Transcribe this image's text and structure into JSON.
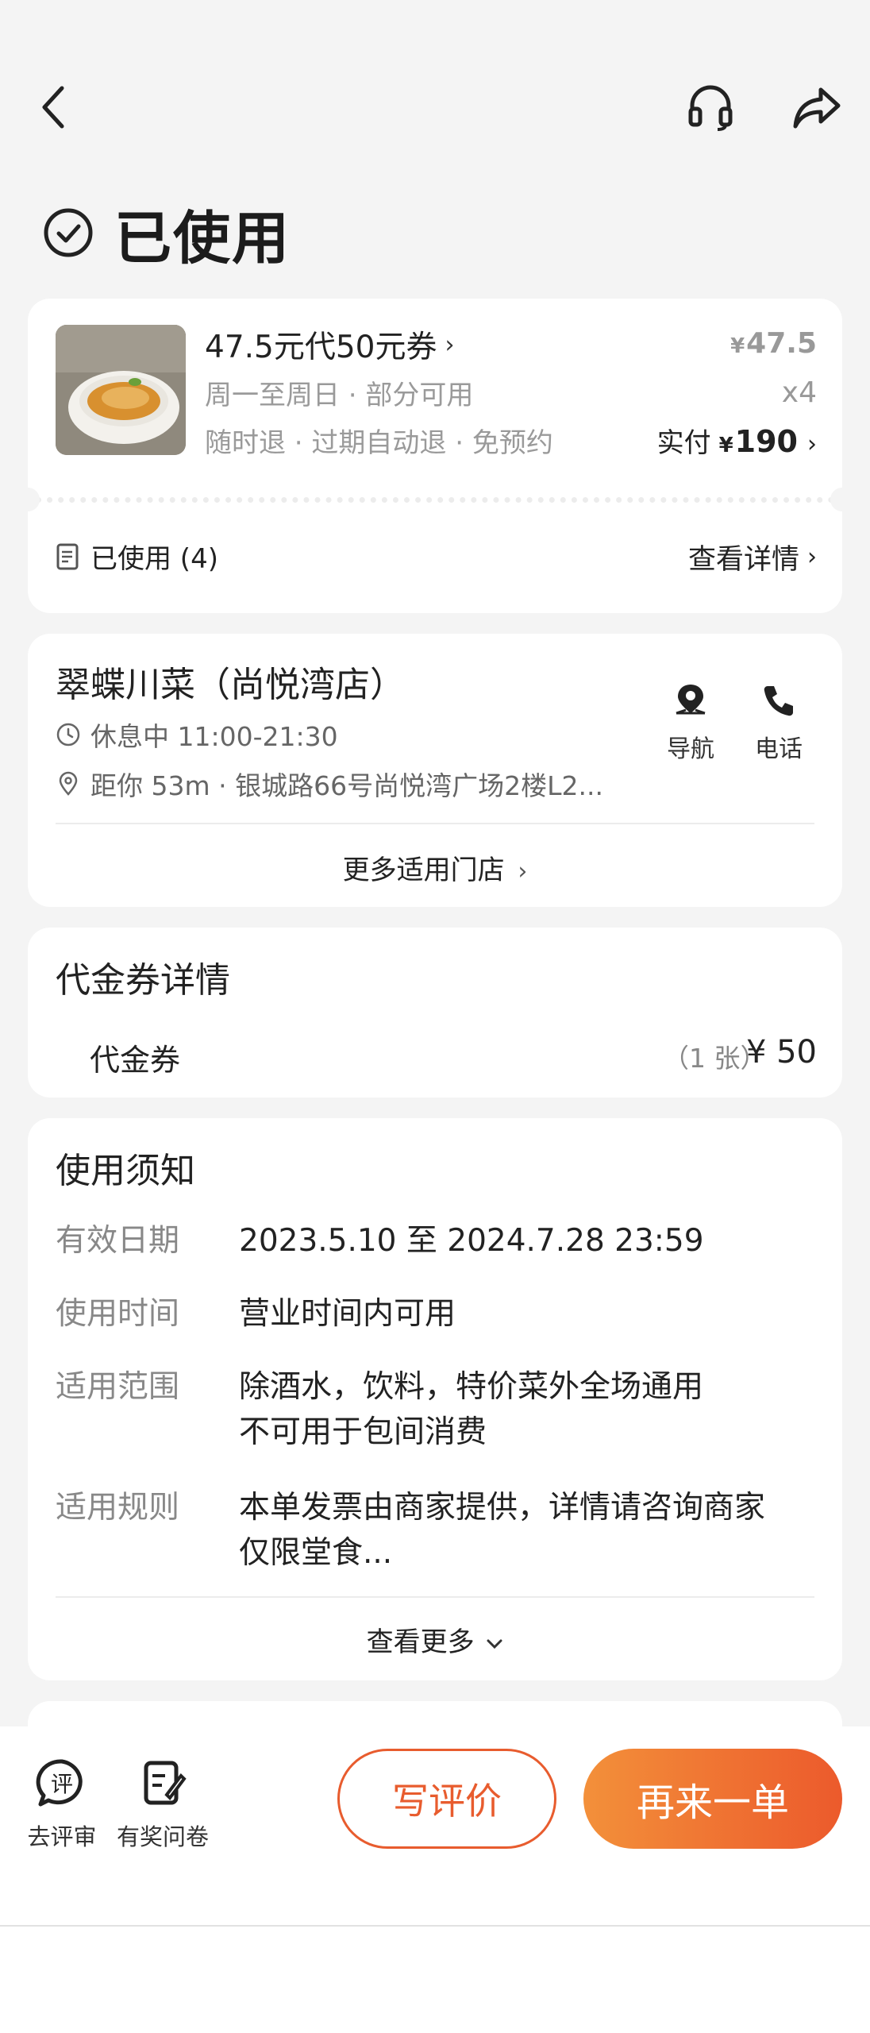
{
  "status": {
    "title": "已使用"
  },
  "voucher": {
    "title": "47.5元代50元券",
    "subtitle1": "周一至周日 · 部分可用",
    "subtitle2": "随时退 · 过期自动退 · 免预约",
    "price_symbol": "¥",
    "price": "47.5",
    "quantity": "x4",
    "paid_label": "实付",
    "paid_symbol": "¥",
    "paid_amount": "190",
    "used_label": "已使用 (4)",
    "detail_link": "查看详情"
  },
  "store": {
    "name": "翠蝶川菜（尚悦湾店）",
    "hours": "休息中 11:00-21:30",
    "address": "距你 53m ·  银城路66号尚悦湾广场2楼L2...",
    "nav_label": "导航",
    "phone_label": "电话",
    "more_stores": "更多适用门店"
  },
  "coupon_detail": {
    "title": "代金券详情",
    "name": "代金券",
    "count": "（1 张）",
    "price": "¥ 50"
  },
  "notice": {
    "title": "使用须知",
    "rows": [
      {
        "label": "有效日期",
        "line1": "2023.5.10 至 2024.7.28 23:59",
        "line2": ""
      },
      {
        "label": "使用时间",
        "line1": "营业时间内可用",
        "line2": ""
      },
      {
        "label": "适用范围",
        "line1": "除酒水，饮料，特价菜外全场通用",
        "line2": "不可用于包间消费"
      },
      {
        "label": "适用规则",
        "line1": "本单发票由商家提供，详情请咨询商家",
        "line2": "仅限堂食..."
      }
    ],
    "see_more": "查看更多"
  },
  "bottom_bar": {
    "review_label": "去评审",
    "survey_label": "有奖问卷",
    "write_review": "写评价",
    "reorder": "再来一单"
  },
  "colors": {
    "accent": "#e85c2e",
    "gradient_start": "#f3903a",
    "gradient_end": "#ec5a2c"
  }
}
